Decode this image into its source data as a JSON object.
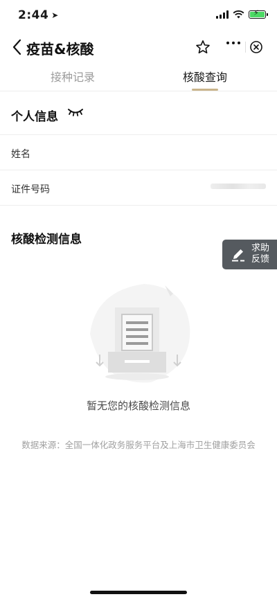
{
  "status_bar": {
    "time": "2:44"
  },
  "nav": {
    "title": "疫苗&核酸"
  },
  "tabs": [
    {
      "label": "接种记录",
      "selected": false
    },
    {
      "label": "核酸查询",
      "selected": true
    }
  ],
  "personal_info": {
    "title": "个人信息",
    "fields": [
      {
        "label": "姓名"
      },
      {
        "label": "证件号码"
      }
    ]
  },
  "test_info": {
    "title": "核酸检测信息",
    "empty_text": "暂无您的核酸检测信息",
    "source": "数据来源：全国一体化政务服务平台及上海市卫生健康委员会"
  },
  "help_button": {
    "line1": "求助",
    "line2": "反馈"
  },
  "colors": {
    "tab_underline": "#c9b48a",
    "help_bg": "#555a5f",
    "battery": "#4cd964"
  }
}
